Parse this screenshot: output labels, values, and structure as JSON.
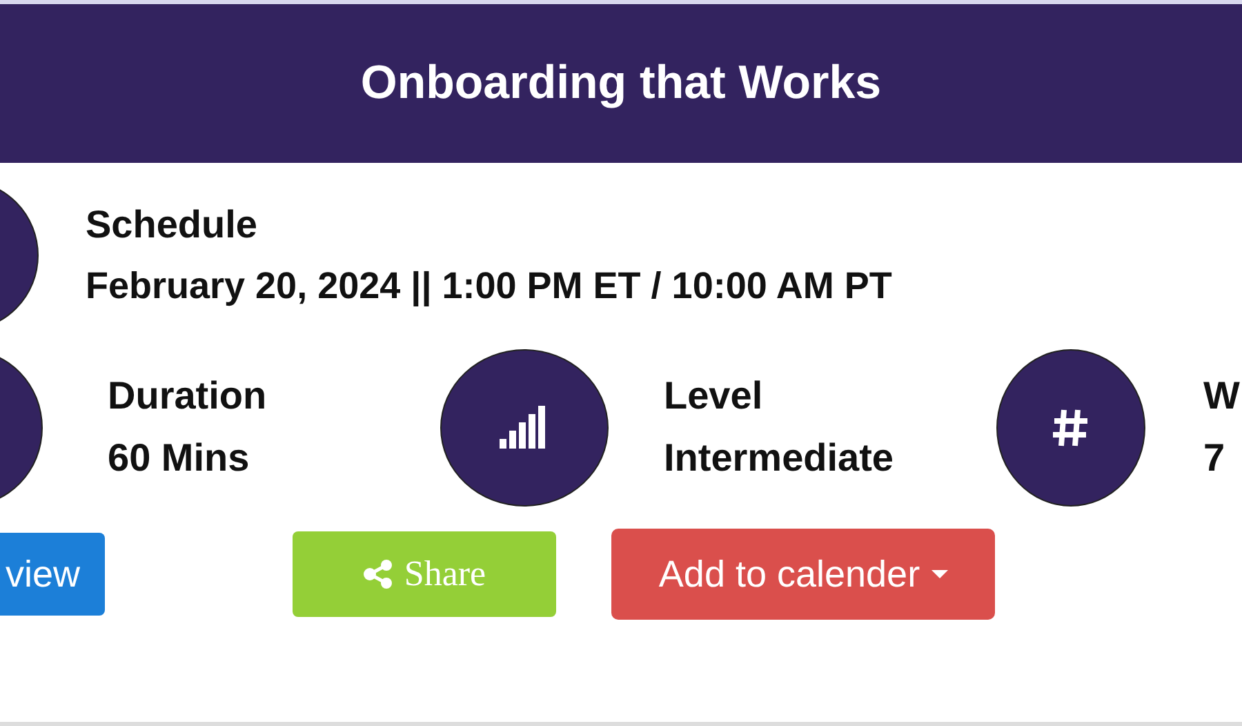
{
  "header": {
    "title": "Onboarding that Works"
  },
  "schedule": {
    "label": "Schedule",
    "value": "February 20, 2024 || 1:00 PM ET / 10:00 AM PT"
  },
  "details": [
    {
      "kind": "blank",
      "label": "Duration",
      "value": "60 Mins"
    },
    {
      "kind": "signal",
      "label": "Level",
      "value": "Intermediate"
    },
    {
      "kind": "hash",
      "label": "W",
      "value": "7"
    }
  ],
  "buttons": [
    {
      "kind": "preview",
      "label": "view"
    },
    {
      "kind": "share",
      "label": "Share"
    },
    {
      "kind": "calendar",
      "label": "Add to calender"
    }
  ]
}
